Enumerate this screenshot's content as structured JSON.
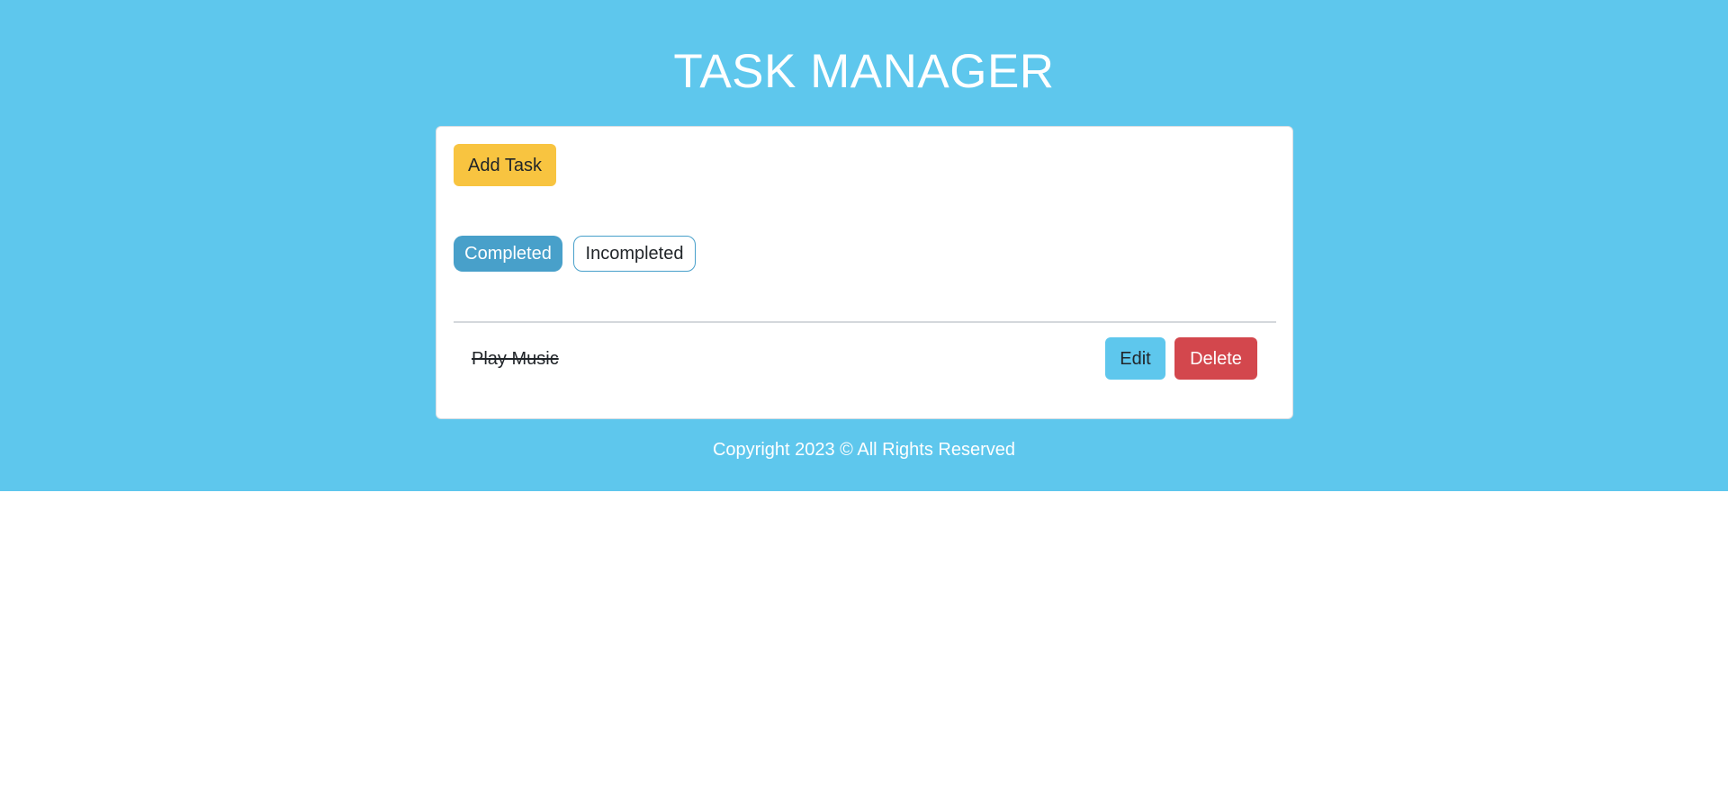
{
  "header": {
    "title": "TASK MANAGER"
  },
  "toolbar": {
    "add_task_label": "Add Task"
  },
  "filters": {
    "completed_label": "Completed",
    "incompleted_label": "Incompleted",
    "active": "Completed"
  },
  "tasks": [
    {
      "title": "Play Music",
      "completed": true,
      "edit_label": "Edit",
      "delete_label": "Delete"
    }
  ],
  "footer": {
    "copyright": "Copyright 2023 © All Rights Reserved"
  },
  "colors": {
    "background": "#5ec7ed",
    "add_button": "#f8c440",
    "filter_active": "#48a0ca",
    "edit_button": "#5ec7ed",
    "delete_button": "#d3474d"
  }
}
